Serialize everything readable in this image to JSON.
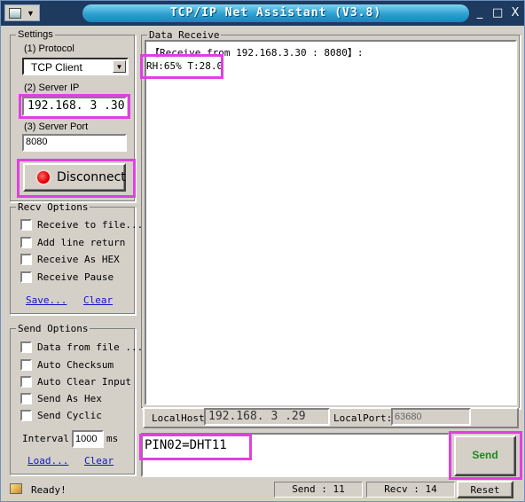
{
  "window": {
    "title": "TCP/IP Net Assistant (V3.8)",
    "controls": [
      "_",
      "□",
      "X"
    ]
  },
  "settings": {
    "legend": "Settings",
    "protocol_label": "(1) Protocol",
    "protocol_value": "TCP Client",
    "server_ip_label": "(2) Server IP",
    "server_ip_value": "192.168. 3 .30",
    "server_port_label": "(3) Server Port",
    "server_port_value": "8080",
    "disconnect_label": "Disconnect"
  },
  "recv_options": {
    "legend": "Recv Options",
    "items": [
      "Receive to file...",
      "Add line return",
      "Receive As HEX",
      "Receive Pause"
    ],
    "save_link": "Save...",
    "clear_link": "Clear"
  },
  "send_options": {
    "legend": "Send Options",
    "items": [
      "Data from file ...",
      "Auto Checksum",
      "Auto Clear Input",
      "Send As Hex",
      "Send Cyclic"
    ],
    "interval_label": "Interval",
    "interval_value": "1000",
    "interval_unit": "ms",
    "load_link": "Load...",
    "clear_link": "Clear"
  },
  "data_receive": {
    "legend": "Data Receive",
    "header_line": "【Receive from 192.168.3.30 : 8080】:",
    "data_line": "RH:65% T:28.0"
  },
  "local": {
    "host_label": "LocalHost:",
    "host_value": "192.168. 3 .29",
    "port_label": "LocalPort:",
    "port_value": "63680"
  },
  "send": {
    "input_value": "PIN02=DHT11",
    "button_label": "Send"
  },
  "statusbar": {
    "ready": "Ready!",
    "send_count": "Send : 11",
    "recv_count": "Recv : 14",
    "reset_label": "Reset"
  },
  "colors": {
    "highlight": "#e040e0",
    "title_bar": "#1e3a5f",
    "send_text": "#1a8a1a",
    "link": "#1414c8",
    "led": "#e00000"
  }
}
